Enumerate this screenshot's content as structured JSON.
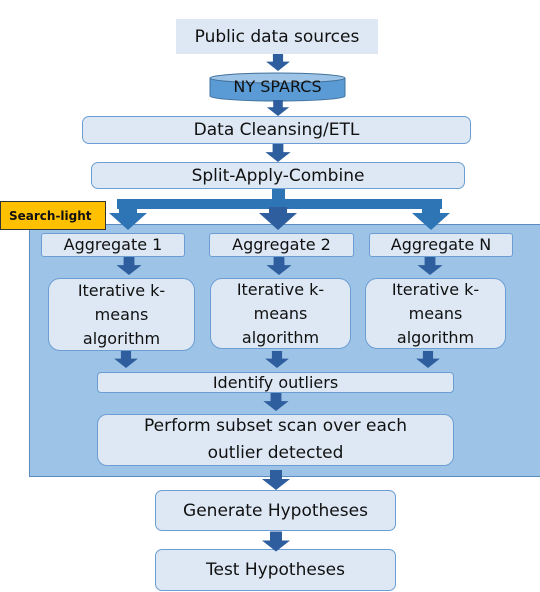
{
  "sources": "Public data sources",
  "database": "NY SPARCS",
  "cleansing": "Data Cleansing/ETL",
  "split": "Split-Apply-Combine",
  "region_label": "Search-light",
  "aggregates": [
    "Aggregate  1",
    "Aggregate  2",
    "Aggregate  N"
  ],
  "kmeans": [
    "Iterative k-means algorithm",
    "Iterative k-means algorithm",
    "Iterative k-means algorithm"
  ],
  "outliers": "Identify outliers",
  "subset_scan": "Perform subset scan over each outlier detected",
  "generate": "Generate Hypotheses",
  "test": "Test  Hypotheses",
  "colors": {
    "box_fill": "#dde8f4",
    "arrow": "#2f5e9e",
    "region": "#9dc3e6",
    "database": "#5b9bd5",
    "tag": "#ffc000"
  }
}
